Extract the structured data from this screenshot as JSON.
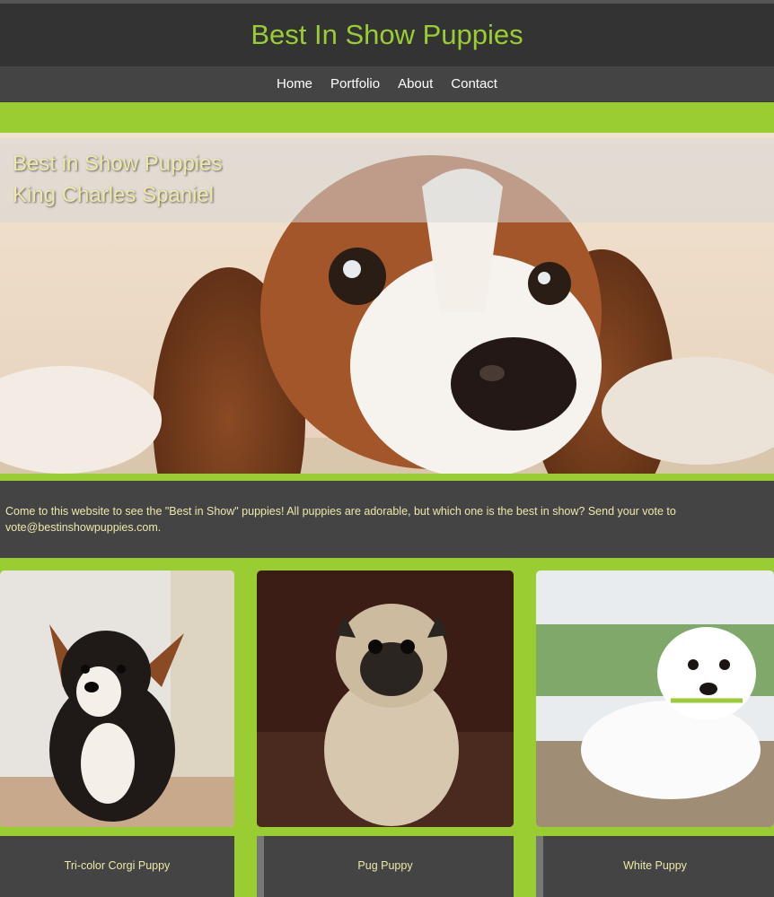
{
  "header": {
    "title": "Best In Show Puppies"
  },
  "nav": {
    "items": [
      "Home",
      "Portfolio",
      "About",
      "Contact"
    ]
  },
  "hero": {
    "line1": "Best in Show Puppies",
    "line2": "King Charles Spaniel"
  },
  "intro": {
    "text": "Come to this website to see the \"Best in Show\" puppies! All puppies are adorable, but which one is the best in show? Send your vote to vote@bestinshowpuppies.com."
  },
  "cards": [
    {
      "label": "Tri-color Corgi Puppy"
    },
    {
      "label": "Pug Puppy"
    },
    {
      "label": "White Puppy"
    }
  ],
  "colors": {
    "accent": "#9acd32",
    "header_bg": "#333333",
    "nav_bg": "#444444",
    "text_gold": "#eee8aa"
  }
}
